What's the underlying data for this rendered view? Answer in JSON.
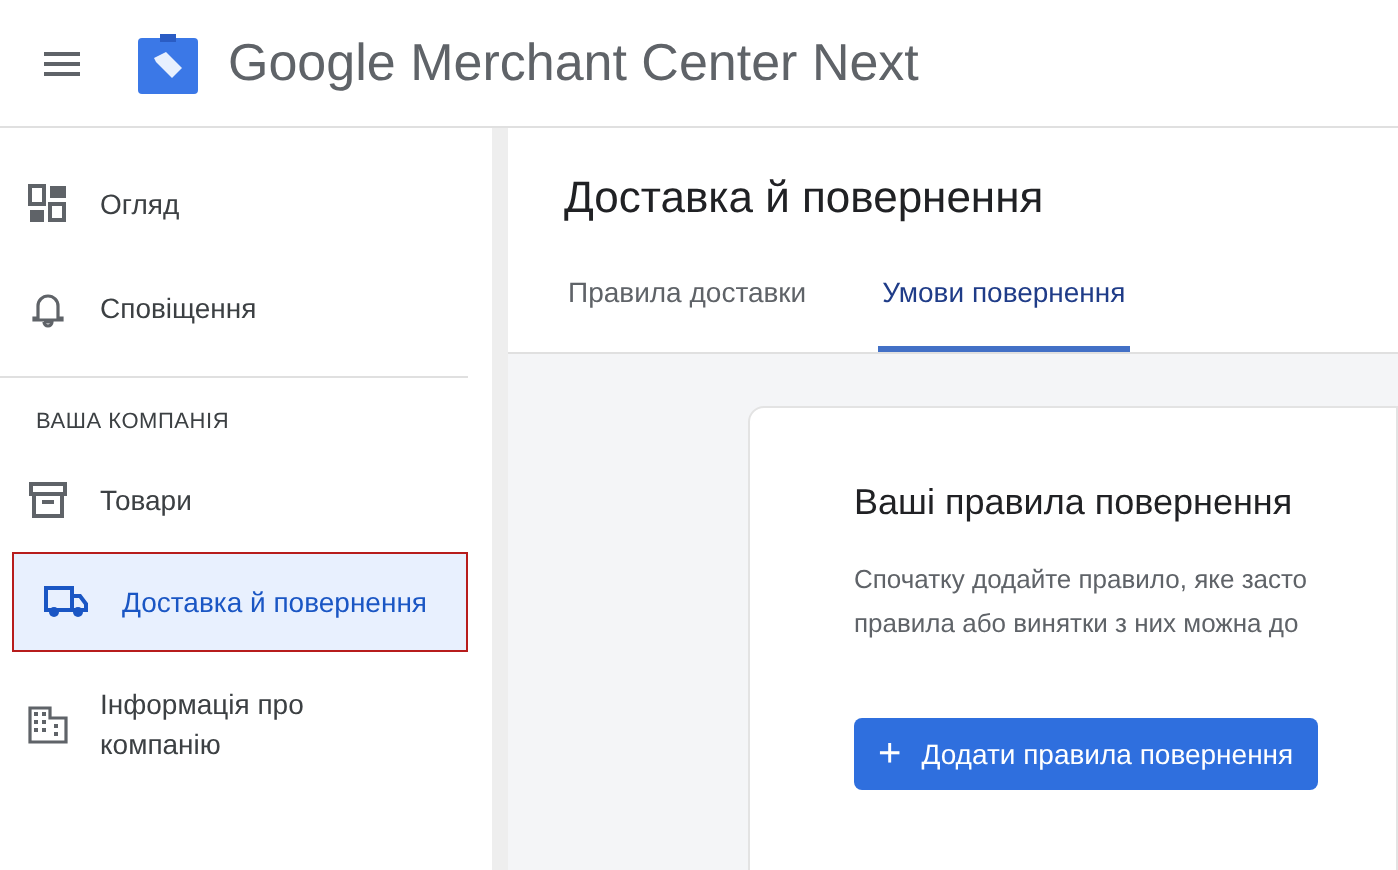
{
  "header": {
    "title_brand": "Google",
    "title_rest": "Merchant Center Next"
  },
  "sidebar": {
    "items": [
      {
        "label": "Огляд",
        "kind": "dashboard",
        "selected": false
      },
      {
        "label": "Сповіщення",
        "kind": "bell",
        "selected": false
      }
    ],
    "section": {
      "title": "ВАША КОМПАНІЯ",
      "items": [
        {
          "label": "Товари",
          "kind": "archive",
          "selected": false
        },
        {
          "label": "Доставка й повернення",
          "kind": "truck",
          "selected": true
        },
        {
          "label": "Інформація про компанію",
          "kind": "building",
          "selected": false
        }
      ]
    }
  },
  "page": {
    "title": "Доставка й повернення",
    "tabs": [
      {
        "label": "Правила доставки",
        "selected": false
      },
      {
        "label": "Умови повернення",
        "selected": true
      }
    ],
    "card": {
      "title": "Ваші правила повернення",
      "description_lines": [
        "Спочатку додайте правило, яке засто",
        "правила або винятки з них можна до"
      ],
      "button": {
        "icon": "+",
        "label": "Додати правила повернення"
      }
    }
  }
}
